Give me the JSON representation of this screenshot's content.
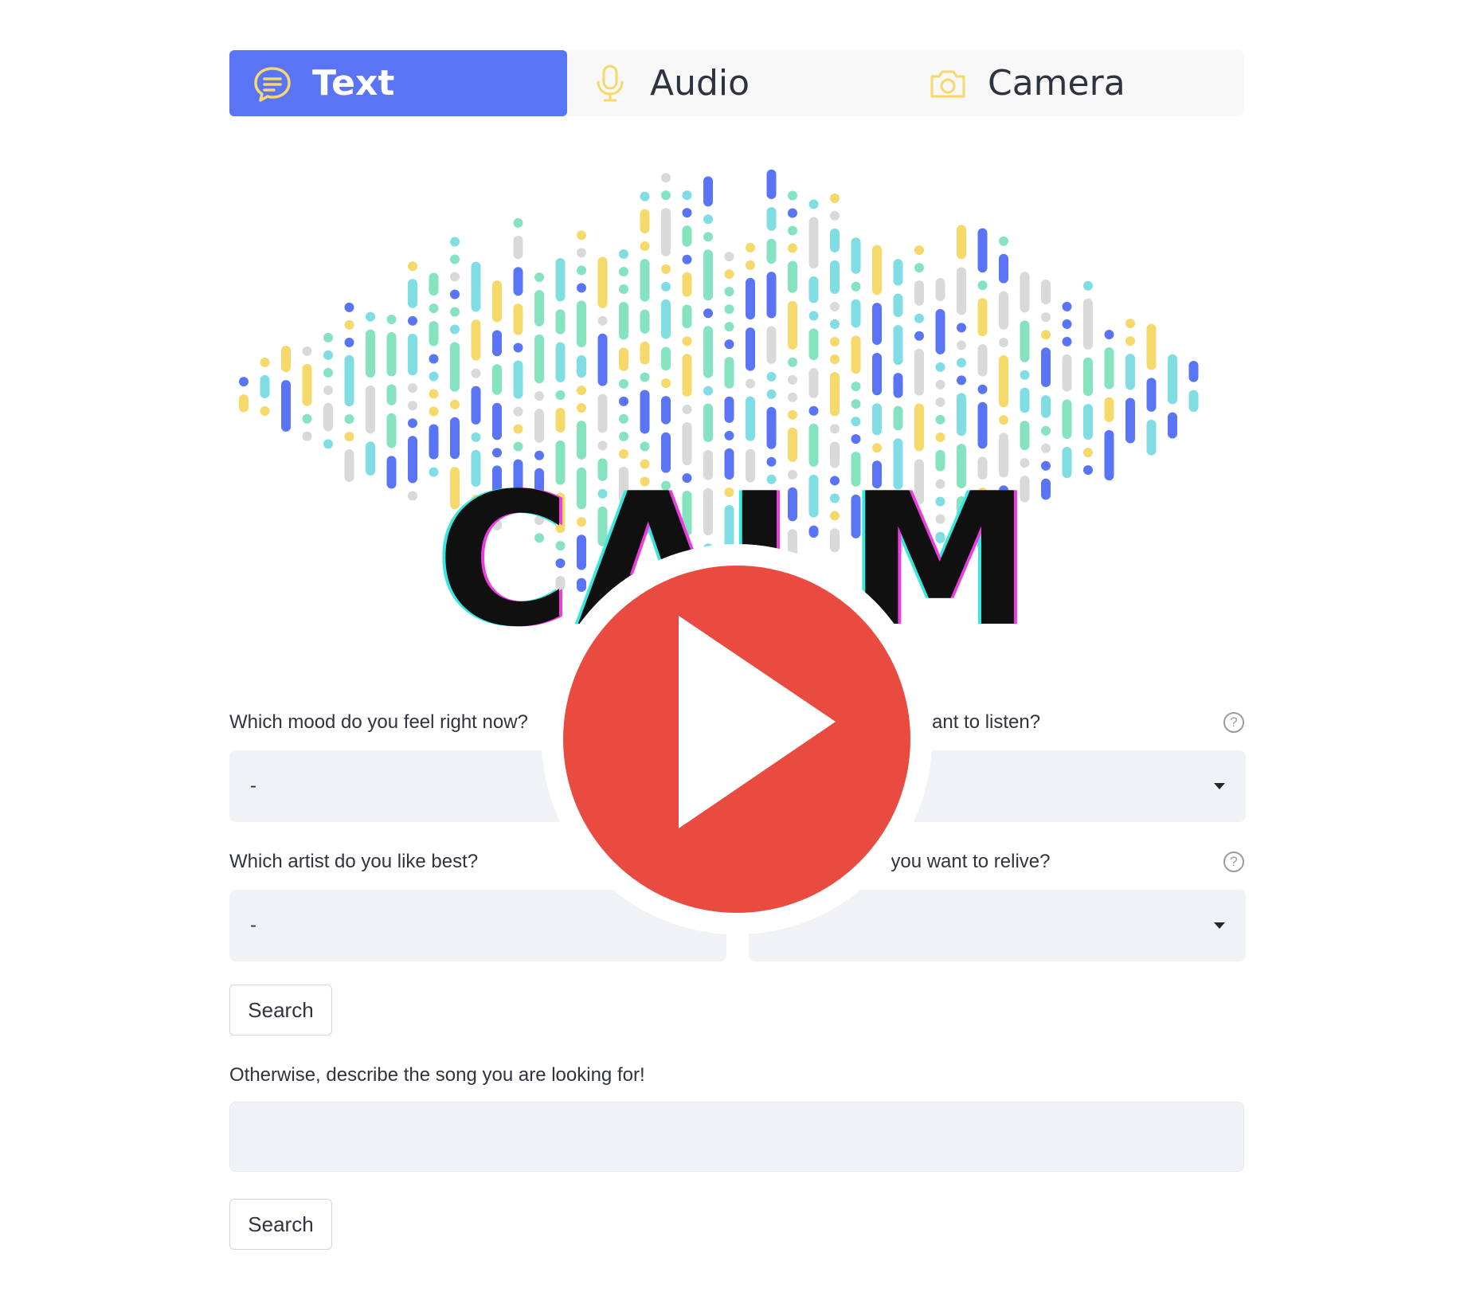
{
  "tabs": [
    {
      "label": "Text",
      "icon": "chat-bubble-icon",
      "active": true
    },
    {
      "label": "Audio",
      "icon": "microphone-icon",
      "active": false
    },
    {
      "label": "Camera",
      "icon": "camera-icon",
      "active": false
    }
  ],
  "logo": {
    "word": "CALM"
  },
  "form": {
    "mood": {
      "label": "Which mood do you feel right now?",
      "value": "-"
    },
    "listen": {
      "label_visible": "ant to listen?",
      "value": "-"
    },
    "artist": {
      "label": "Which artist do you like best?",
      "value": "-"
    },
    "relive": {
      "label_visible": "do you want to relive?",
      "value": "-"
    },
    "help_symbol": "?",
    "search_button_1": "Search",
    "describe": {
      "label": "Otherwise, describe the song you are looking for!",
      "value": "",
      "placeholder": ""
    },
    "search_button_2": "Search"
  },
  "colors": {
    "tab_active": "#5a74f6",
    "icon_yellow": "#f5d96b",
    "play_red": "#e94b40",
    "wave_blue": "#5a74f6",
    "wave_green": "#86e3c0",
    "wave_yellow": "#f5d96b",
    "wave_cyan": "#7fdde3",
    "wave_gray": "#d9d9d9"
  }
}
